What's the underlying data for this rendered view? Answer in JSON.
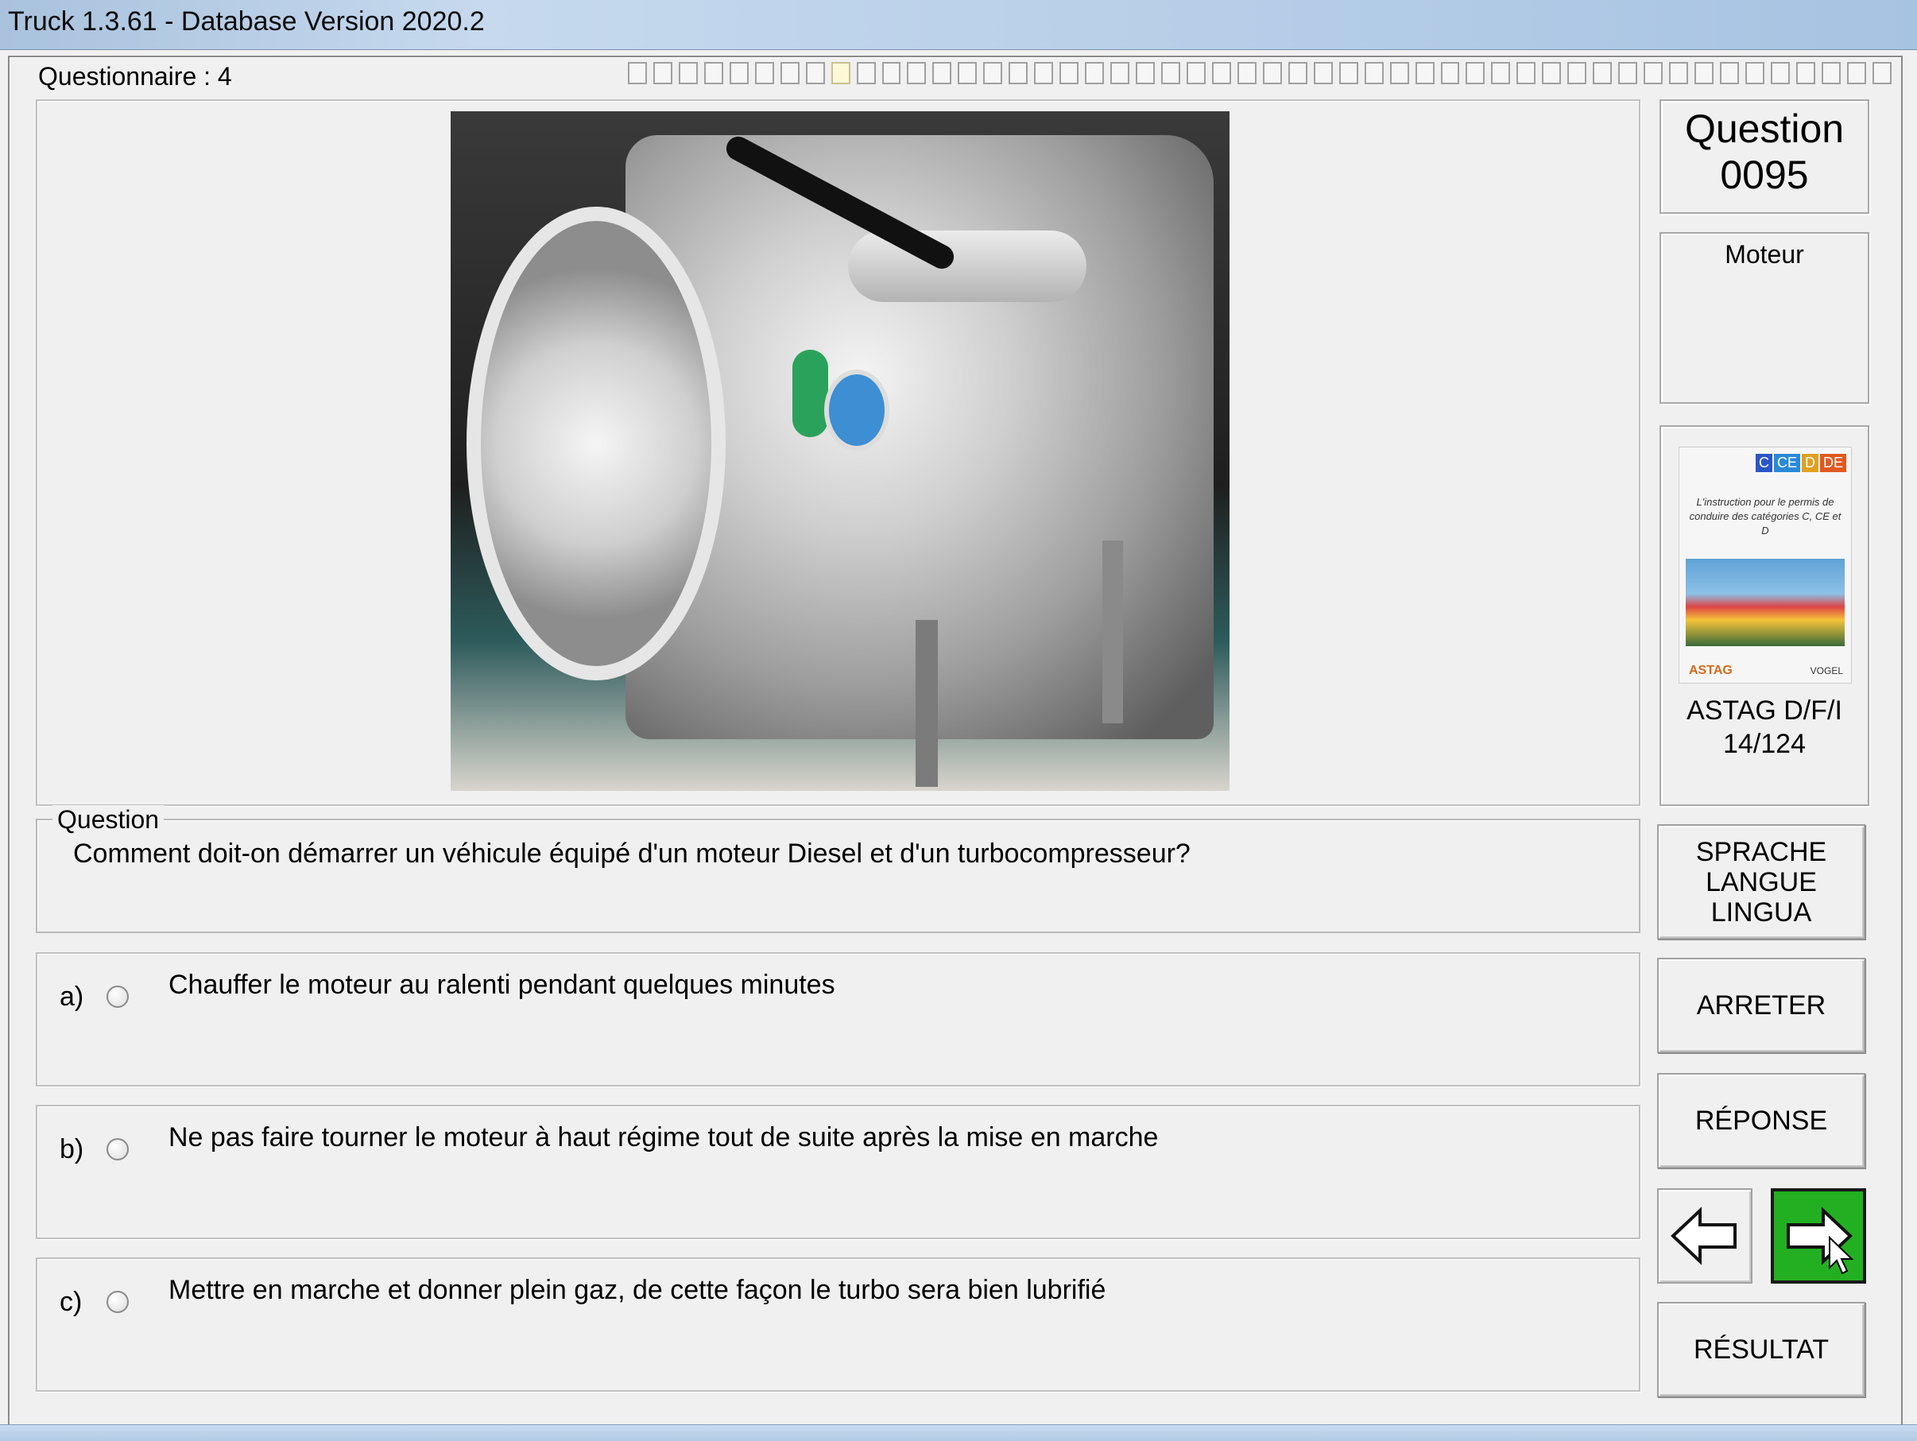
{
  "window": {
    "title": "Truck 1.3.61 - Database Version 2020.2"
  },
  "questionnaire": {
    "label": "Questionnaire : 4",
    "progress_total": 50,
    "progress_current": 9
  },
  "question_panel": {
    "legend": "Question",
    "text": "Comment doit-on démarrer un véhicule équipé d'un moteur Diesel et d'un turbocompresseur?"
  },
  "answers": [
    {
      "letter": "a)",
      "text": "Chauffer le moteur au ralenti pendant quelques minutes",
      "selected": false
    },
    {
      "letter": "b)",
      "text": "Ne pas faire tourner le moteur à haut régime tout de suite après la mise en marche",
      "selected": false
    },
    {
      "letter": "c)",
      "text": "Mettre en marche et donner plein gaz, de cette façon le turbo sera bien lubrifié",
      "selected": false
    }
  ],
  "sidebar": {
    "question_label": "Question",
    "question_number": "0095",
    "category": "Moteur",
    "book": {
      "badges": [
        "C",
        "CE",
        "D",
        "DE"
      ],
      "badge_colors": [
        "#2a56c6",
        "#2a8ad6",
        "#e0a020",
        "#e05a20"
      ],
      "cover_text": "L'instruction pour le permis de conduire des catégories C, CE et D",
      "logo_left": "ASTAG",
      "logo_right": "VOGEL",
      "title": "ASTAG D/F/I",
      "page": "14/124"
    },
    "language_button": [
      "SPRACHE",
      "LANGUE",
      "LINGUA"
    ],
    "stop_button": "ARRETER",
    "answer_button": "RÉPONSE",
    "result_button": "RÉSULTAT"
  },
  "navigation": {
    "prev_icon": "arrow-left-icon",
    "next_icon": "arrow-right-icon",
    "next_color": "#22b022"
  }
}
